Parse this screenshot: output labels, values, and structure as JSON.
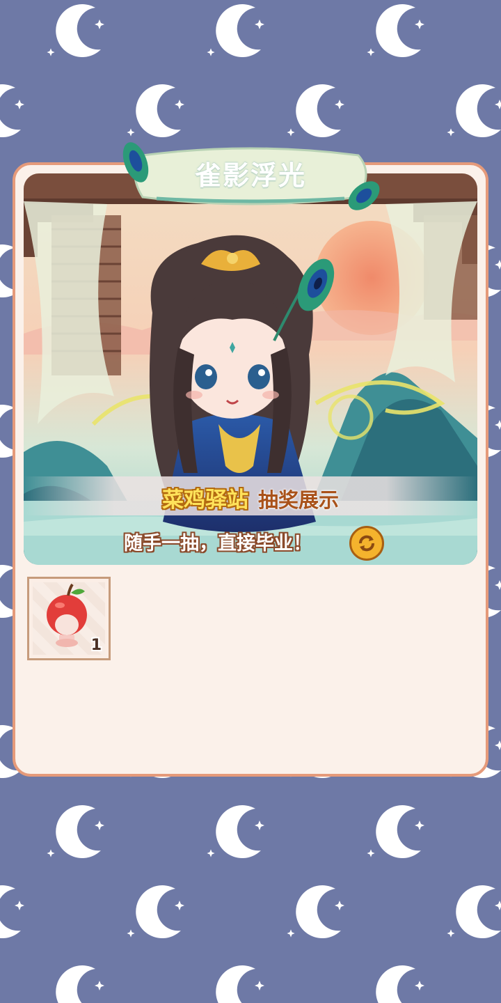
{
  "banner": {
    "title": "雀影浮光",
    "brand": "菜鸡驿站",
    "subtitle": "抽奖展示",
    "slogan": "随手一抽，直接毕业！"
  },
  "reward_items": [
    {
      "icon": "apple-hat-icon",
      "count": "1"
    }
  ],
  "colors": {
    "background": "#6e79a6",
    "moon": "#ffffff",
    "panel_border": "#e59a7a",
    "panel_fill": "#fbf1ea",
    "brand_text": "#ffe25a",
    "subtitle_text": "#a9521a"
  }
}
